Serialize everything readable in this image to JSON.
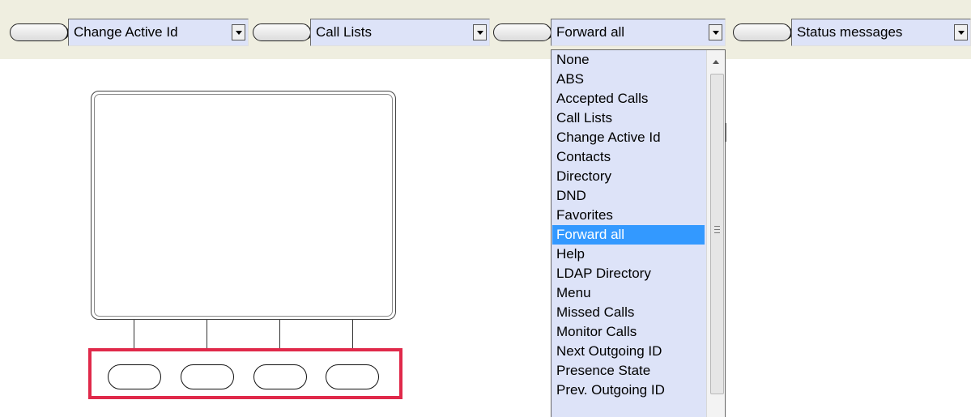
{
  "toolbar": {
    "selects": [
      {
        "value": "Change Active Id"
      },
      {
        "value": "Call Lists"
      },
      {
        "value": "Forward all"
      },
      {
        "value": "Status messages"
      }
    ]
  },
  "dropdown": {
    "items": [
      "None",
      "ABS",
      "Accepted Calls",
      "Call Lists",
      "Change Active Id",
      "Contacts",
      "Directory",
      "DND",
      "Favorites",
      "Forward all",
      "Help",
      "LDAP Directory",
      "Menu",
      "Missed Calls",
      "Monitor Calls",
      "Next Outgoing ID",
      "Presence State",
      "Prev. Outgoing ID"
    ],
    "selected": "Forward all"
  },
  "colors": {
    "highlight_border": "#e0294a",
    "selection": "#3399ff",
    "list_bg": "#dde3f8"
  }
}
